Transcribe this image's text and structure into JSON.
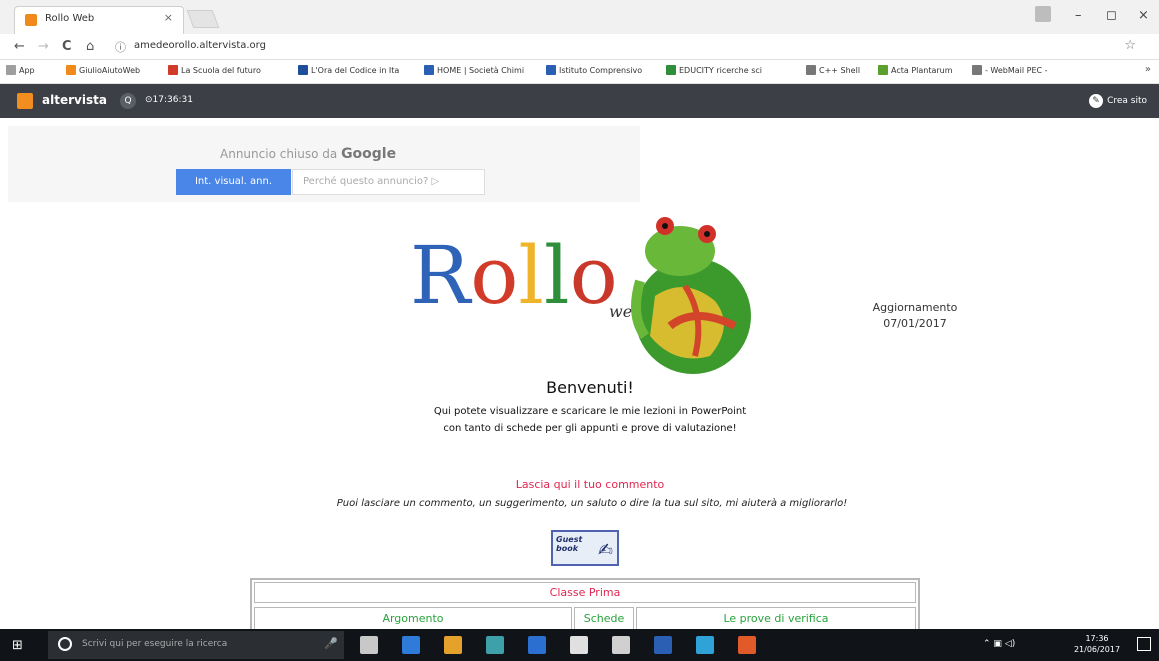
{
  "browser": {
    "tab_title": "Rollo Web",
    "tab_close": "×",
    "window_controls": [
      "–",
      "◻",
      "×"
    ],
    "nav": {
      "back": "←",
      "forward": "→",
      "reload": "C",
      "home": "⌂"
    },
    "omnibox_info": "ⓘ",
    "url": "amedeorollo.altervista.org",
    "star": "☆",
    "bookmarks": [
      {
        "label": "App",
        "color": "#9e9e9e"
      },
      {
        "label": "GiulioAiutoWeb",
        "color": "#f08a1d"
      },
      {
        "label": "La Scuola del futuro",
        "color": "#d23a2a"
      },
      {
        "label": "L'Ora del Codice in Ita",
        "color": "#1e4d9c"
      },
      {
        "label": "HOME | Società Chimi",
        "color": "#2b5fb3"
      },
      {
        "label": "Istituto Comprensivo",
        "color": "#2b5fb3"
      },
      {
        "label": "EDUCITY ricerche sci",
        "color": "#2e8e3a"
      },
      {
        "label": "C++ Shell",
        "color": "#777777"
      },
      {
        "label": "Acta Plantarum",
        "color": "#5aa02c"
      },
      {
        "label": "- WebMail PEC -",
        "color": "#777777"
      }
    ],
    "bookmarks_more": "»"
  },
  "altervista": {
    "brand": "altervista",
    "search_icon": "Q",
    "clock": "⊙17:36:31",
    "create_site": "Crea sito",
    "create_icon": "✎"
  },
  "ad": {
    "closed_prefix": "Annuncio chiuso da ",
    "closed_brand": "Google",
    "button": "Int. visual. ann.",
    "why": "Perché questo annuncio? ▷"
  },
  "logo": {
    "letters": [
      "R",
      "o",
      "l",
      "l",
      "o"
    ],
    "suffix": "web"
  },
  "update": {
    "label": "Aggiornamento",
    "date": "07/01/2017"
  },
  "welcome": {
    "title": "Benvenuti!",
    "line1": "Qui potete visualizzare e scaricare le mie lezioni in PowerPoint",
    "line2": "con tanto di schede per gli appunti e prove di valutazione!"
  },
  "comment": {
    "link": "Lascia qui il tuo commento",
    "text": "Puoi lasciare un commento, un suggerimento, un saluto o dire la tua sul sito, mi aiuterà a migliorarlo!"
  },
  "guestbook": {
    "line1": "Guest",
    "line2": "book",
    "icon": "✍"
  },
  "table": {
    "header": "Classe Prima",
    "columns": [
      "Argomento",
      "Schede",
      "Le prove di verifica"
    ]
  },
  "taskbar": {
    "start": "⊞",
    "search_placeholder": "Scrivi qui per eseguire la ricerca",
    "mic": "🎤",
    "apps": [
      "#c8c8c8",
      "#2f7bd9",
      "#e4a12c",
      "#3ea0a8",
      "#2b6fd1",
      "#e0e0e0",
      "#d0d0d0",
      "#2b5fb3",
      "#2fa3d8",
      "#e05a2a"
    ],
    "tray": "⌃  ▣  ◁)",
    "time": "17:36",
    "date": "21/06/2017"
  }
}
